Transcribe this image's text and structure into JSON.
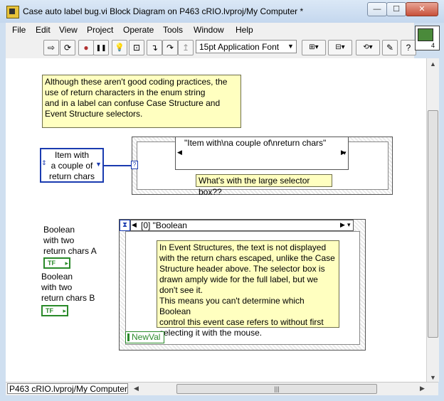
{
  "window": {
    "title": "Case auto label bug.vi Block Diagram on P463 cRIO.lvproj/My Computer *",
    "controls": {
      "minimize": "—",
      "maximize": "☐",
      "close": "✕"
    }
  },
  "menu": [
    "File",
    "Edit",
    "View",
    "Project",
    "Operate",
    "Tools",
    "Window",
    "Help"
  ],
  "toolbar": {
    "buttons": [
      {
        "name": "run-arrow-icon",
        "glyph": "⇨"
      },
      {
        "name": "run-continuously-icon",
        "glyph": "⟳"
      },
      {
        "name": "abort-icon",
        "glyph": "●"
      },
      {
        "name": "pause-icon",
        "glyph": "❚❚"
      },
      {
        "name": "highlight-execution-icon",
        "glyph": "💡"
      },
      {
        "name": "retain-wire-values-icon",
        "glyph": "⊡"
      },
      {
        "name": "step-into-icon",
        "glyph": "↴"
      },
      {
        "name": "step-over-icon",
        "glyph": "↷"
      },
      {
        "name": "step-out-icon",
        "glyph": "↥"
      }
    ],
    "font_select": "15pt Application Font",
    "help_glyph": "?",
    "connector_number": "4"
  },
  "diagram": {
    "comment_top": [
      "Although these aren't good coding practices, the",
      "use of return characters in the enum string",
      "and in a label can confuse Case Structure and",
      "Event Structure selectors."
    ],
    "enum_control": [
      "Item with",
      "a couple of",
      "return chars"
    ],
    "case_selector_label": "\"Item with\\na couple of\\nreturn chars\"",
    "case_comment": "What's with the large selector box??",
    "boolean_a": [
      "Boolean",
      "with two",
      "return chars A"
    ],
    "boolean_b": [
      "Boolean",
      "with two",
      "return chars B"
    ],
    "tf_label": "TF",
    "event_selector_label": "[0] \"Boolean",
    "event_comment": [
      "In Event Structures, the text is not displayed",
      "with the return chars escaped, unlike the Case",
      "Structure header above. The selector box is",
      "drawn amply wide for the full label, but we",
      "don't see it.",
      "This means you can't determine which Boolean",
      "control this event case refers to without first",
      "selecting it with the mouse."
    ],
    "newval": "NewVal"
  },
  "status": {
    "path": "P463 cRIO.lvproj/My Computer"
  }
}
